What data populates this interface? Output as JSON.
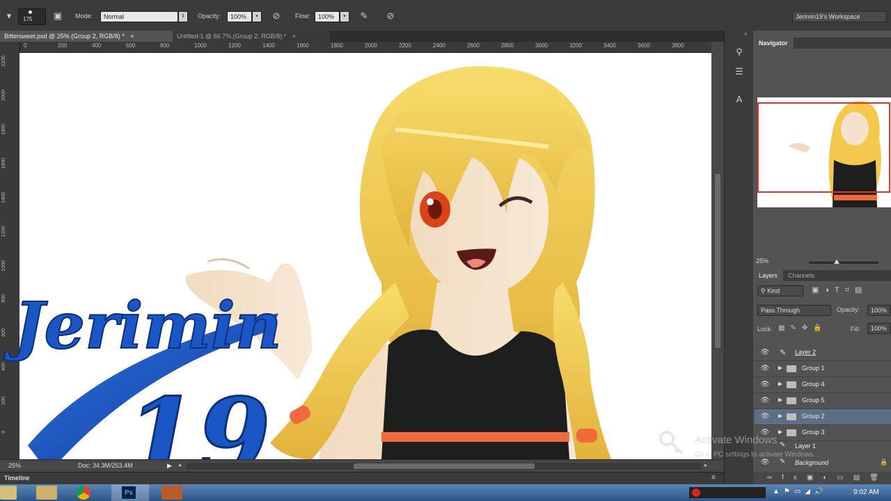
{
  "options_bar": {
    "brush_size": "175",
    "mode_label": "Mode:",
    "mode_value": "Normal",
    "opacity_label": "Opacity:",
    "opacity_value": "100%",
    "flow_label": "Flow:",
    "flow_value": "100%",
    "workspace": "Jerimin19's Workspace"
  },
  "tabs": [
    {
      "label": "Bittersweet.psd @ 25% (Group 2, RGB/8) *",
      "close": "×"
    },
    {
      "label": "Untitled-1 @ 66.7% (Group 2, RGB/8) *",
      "close": "×"
    }
  ],
  "ruler_h": [
    "0",
    "200",
    "400",
    "600",
    "800",
    "1000",
    "1200",
    "1400",
    "1600",
    "1800",
    "2000",
    "2200",
    "2400",
    "2600",
    "2800",
    "3000",
    "3200",
    "3400",
    "3600",
    "3800"
  ],
  "ruler_v": [
    "2200",
    "2000",
    "1800",
    "1600",
    "1400",
    "1200",
    "1000",
    "800",
    "600",
    "400",
    "200",
    "0"
  ],
  "status": {
    "zoom": "25%",
    "doc": "Doc: 34.3M/253.4M"
  },
  "timeline_label": "Timeline",
  "navigator": {
    "tab": "Navigator",
    "zoom": "25%"
  },
  "layers_panel": {
    "tabs": [
      "Layers",
      "Channels"
    ],
    "kind": "Kind",
    "blend": "Pass Through",
    "opacity_label": "Opacity:",
    "opacity_value": "100%",
    "lock_label": "Lock:",
    "fill_label": "Fill:",
    "fill_value": "100%",
    "layers": [
      {
        "name": "Layer 2",
        "type": "layer",
        "selected": false
      },
      {
        "name": "Group 1",
        "type": "group",
        "selected": false
      },
      {
        "name": "Group 4",
        "type": "group",
        "selected": false
      },
      {
        "name": "Group 5",
        "type": "group",
        "selected": false
      },
      {
        "name": "Group 2",
        "type": "group",
        "selected": true
      },
      {
        "name": "Group 3",
        "type": "group",
        "selected": false
      },
      {
        "name": "Layer 1",
        "type": "layer",
        "selected": false
      },
      {
        "name": "Background",
        "type": "layer",
        "selected": false
      }
    ]
  },
  "watermark": {
    "title": "Activate Windows",
    "subtitle": "Go to PC settings to activate Windows."
  },
  "logo_text": {
    "name": "Jerimin",
    "number": "19"
  },
  "taskbar": {
    "time": "9:02 AM"
  },
  "colors": {
    "ps_dark": "#3b3b3b",
    "selected_row": "#5d6e85",
    "logo_blue": "#1a56c4",
    "hair": "#f2c94c"
  }
}
